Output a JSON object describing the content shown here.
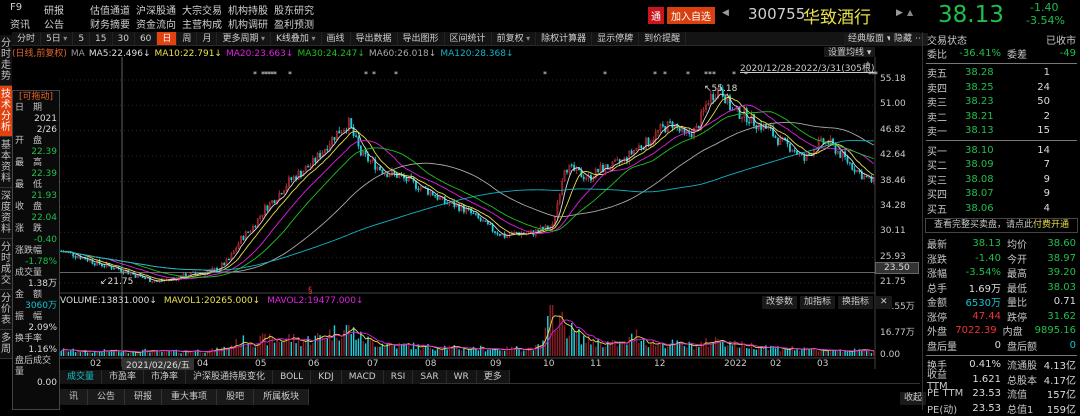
{
  "menu": {
    "row1": [
      "F9",
      "研报",
      "估值通道",
      "沪深股通",
      "大宗交易",
      "机构持股",
      "股东研究"
    ],
    "row2": [
      "资讯",
      "公告",
      "财务摘要",
      "资金流向",
      "主营构成",
      "机构调研",
      "盈利预测"
    ]
  },
  "header": {
    "tong": "通",
    "add_watch": "加入自选",
    "code": "300755",
    "name": "华致酒行",
    "price": "38.13",
    "change": "-1.40",
    "change_pct": "-3.54%"
  },
  "toolbar": {
    "items": [
      "分时",
      "5日",
      "5",
      "15",
      "30",
      "60",
      "日",
      "周",
      "月",
      "更多周期",
      "K线叠加",
      "画线",
      "导出数据",
      "导出图形",
      "区间统计",
      "前复权",
      "除权计算器",
      "显示停牌",
      "到价提醒"
    ],
    "active": "日",
    "dropdowns": [
      "5日",
      "更多周期",
      "K线叠加",
      "前复权"
    ],
    "layout": "经典版面",
    "hide": "隐藏",
    "set_ma": "设置均线"
  },
  "ma_line": {
    "mode": "(日线,前复权)",
    "ma": "MA",
    "items": [
      {
        "text": "MA5:22.496↓",
        "color": "#dddddd"
      },
      {
        "text": "MA10:22.791↓",
        "color": "#e8e04a"
      },
      {
        "text": "MA20:23.663↓",
        "color": "#e020e0"
      },
      {
        "text": "MA30:24.247↓",
        "color": "#20c020"
      },
      {
        "text": "MA60:26.018↓",
        "color": "#aaaaaa"
      },
      {
        "text": "MA120:28.368↓",
        "color": "#12b4c4"
      }
    ]
  },
  "leftnav": [
    "分时走势",
    "技术分析",
    "基本资料",
    "深度资料",
    "分时成交",
    "分价表",
    "多周"
  ],
  "infopanel": {
    "title": "[可拖动]",
    "rows": [
      {
        "label": "日　期",
        "value": "2021",
        "value2": "2/26",
        "color": "white"
      },
      {
        "label": "开　盘",
        "value": "22.39",
        "color": "green"
      },
      {
        "label": "最　高",
        "value": "22.39",
        "color": "green"
      },
      {
        "label": "最　低",
        "value": "21.93",
        "color": "green"
      },
      {
        "label": "收　盘",
        "value": "22.04",
        "color": "green"
      },
      {
        "label": "涨　跌",
        "value": "-0.40",
        "color": "green"
      },
      {
        "label": "涨跌幅",
        "value": "-1.78%",
        "color": "green"
      },
      {
        "label": "成交量",
        "value": "1.38万",
        "color": "white"
      },
      {
        "label": "金　额",
        "value": "3060万",
        "color": "cyan"
      },
      {
        "label": "振　幅",
        "value": "2.09%",
        "color": "white"
      },
      {
        "label": "换手率",
        "value": "1.16%",
        "color": "white"
      },
      {
        "label": "盘后成交量",
        "value": "0.00",
        "color": "white"
      }
    ]
  },
  "chart_data": {
    "type": "candlestick",
    "title": "华致酒行 300755 日线 前复权",
    "range_label": "2020/12/28-2022/3/31(305根)",
    "max_label": "55.18",
    "min_label": "21.75",
    "cursor_date": "2021/02/26/五",
    "cursor_price": "23.50",
    "y_ticks": [
      "55.18",
      "51.00",
      "46.82",
      "42.64",
      "38.46",
      "34.28",
      "30.11",
      "25.93",
      "21.75"
    ],
    "ylim": [
      21.75,
      55.18
    ],
    "x_ticks": [
      "02",
      "04",
      "05",
      "06",
      "07",
      "08",
      "09",
      "10",
      "11",
      "12",
      "2022",
      "02",
      "03"
    ],
    "weekly_close": [
      27,
      26.5,
      25.8,
      25,
      24.5,
      24,
      23.2,
      22.5,
      22.04,
      22.4,
      22.8,
      23.2,
      23.5,
      24,
      25.5,
      29,
      31,
      34,
      36,
      38.5,
      40,
      41.5,
      44,
      46.5,
      48,
      43,
      41.5,
      40,
      39.5,
      38.5,
      37.5,
      36.5,
      35,
      34.5,
      33.5,
      32,
      30.5,
      29.5,
      30,
      29.8,
      30.5,
      31,
      41,
      40,
      39,
      40.5,
      41,
      42,
      44,
      45,
      47,
      48,
      46,
      47,
      52,
      54,
      50,
      49.5,
      48,
      47,
      45,
      44,
      42,
      44.5,
      45,
      43,
      41,
      39.2,
      38.13
    ],
    "weekly_volume_wan": [
      4,
      3.5,
      3,
      3,
      3.5,
      3,
      3,
      3.5,
      3,
      3,
      3,
      3.5,
      3.5,
      4,
      6,
      10,
      9,
      11,
      10,
      12,
      10,
      11,
      14,
      16,
      18,
      12,
      9,
      8,
      7,
      7,
      6,
      6,
      6,
      5,
      5,
      5,
      5,
      4.5,
      5,
      5,
      6,
      30,
      20,
      14,
      10,
      9,
      8,
      8,
      14,
      9,
      8,
      8,
      7,
      7,
      9,
      11,
      8,
      7,
      7,
      6,
      5,
      5,
      4,
      4,
      4,
      4,
      3.5,
      3.5,
      3
    ],
    "volume": {
      "label": "VOLUME:13831.000↓",
      "mavol1": "MAVOL1:20265.000↓",
      "mavol2": "MAVOL2:19477.000↓",
      "y_ticks": [
        "33.55万",
        "16.77万",
        "0.00"
      ],
      "ylim": [
        0,
        33.55
      ],
      "buttons": [
        "改参数",
        "加指标",
        "换指标"
      ]
    }
  },
  "indicator_tabs": [
    "成交量",
    "市盈率",
    "市净率",
    "沪深股通持股变化",
    "BOLL",
    "KDJ",
    "MACD",
    "RSI",
    "SAR",
    "WR",
    "更多"
  ],
  "bottom_tabs": [
    "讯",
    "公告",
    "研报",
    "重大事项",
    "股吧",
    "所属板块"
  ],
  "collapse": "收起",
  "right": {
    "status_label": "交易状态",
    "status": "已收市",
    "weibi_label": "委比",
    "weibi": "-36.41%",
    "weicha_label": "委差",
    "weicha": "-49",
    "sells": [
      {
        "l": "卖五",
        "p": "38.28",
        "v": "1"
      },
      {
        "l": "卖四",
        "p": "38.25",
        "v": "24"
      },
      {
        "l": "卖三",
        "p": "38.23",
        "v": "50"
      },
      {
        "l": "卖二",
        "p": "38.21",
        "v": "2"
      },
      {
        "l": "卖一",
        "p": "38.13",
        "v": "15"
      }
    ],
    "buys": [
      {
        "l": "买一",
        "p": "38.10",
        "v": "14"
      },
      {
        "l": "买二",
        "p": "38.09",
        "v": "7"
      },
      {
        "l": "买三",
        "p": "38.08",
        "v": "9"
      },
      {
        "l": "买四",
        "p": "38.07",
        "v": "9"
      },
      {
        "l": "买五",
        "p": "38.06",
        "v": "4"
      }
    ],
    "promo": "查看完整买卖盘，请点此",
    "promo_link": "付费开通",
    "stats": [
      [
        "最新",
        "38.13",
        "green",
        "均价",
        "38.60",
        "green"
      ],
      [
        "涨跌",
        "-1.40",
        "green",
        "今开",
        "38.97",
        "green"
      ],
      [
        "涨幅",
        "-3.54%",
        "green",
        "最高",
        "39.20",
        "green"
      ],
      [
        "总手",
        "1.69万",
        "white",
        "最低",
        "38.03",
        "green"
      ],
      [
        "金额",
        "6530万",
        "cyan",
        "量比",
        "0.71",
        "white"
      ],
      [
        "涨停",
        "47.44",
        "red",
        "跌停",
        "31.62",
        "green"
      ],
      [
        "外盘",
        "7022.39",
        "red",
        "内盘",
        "9895.16",
        "green"
      ],
      [
        "盘后量",
        "0",
        "white",
        "盘后额",
        "0",
        "cyan"
      ]
    ],
    "stats2": [
      [
        "换手",
        "0.41%",
        "流通股",
        "4.13亿"
      ],
      [
        "收益TTM",
        "1.621",
        "总股本",
        "4.17亿"
      ],
      [
        "PE TTM",
        "23.53",
        "流值",
        "157亿"
      ],
      [
        "PE(动)",
        "23.53",
        "总值1",
        "159亿"
      ]
    ]
  }
}
